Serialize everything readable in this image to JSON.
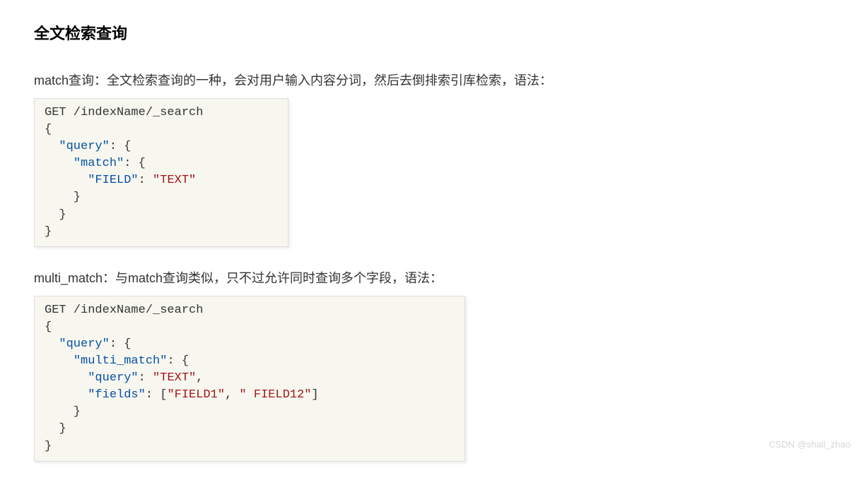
{
  "heading": "全文检索查询",
  "para1": "match查询：全文检索查询的一种，会对用户输入内容分词，然后去倒排索引库检索，语法：",
  "para2": "multi_match：与match查询类似，只不过允许同时查询多个字段，语法：",
  "watermark": "CSDN @shall_zhao",
  "code1": {
    "line1": "GET /indexName/_search",
    "line2": "{",
    "key_query": "\"query\"",
    "sep": ": {",
    "key_match": "\"match\"",
    "key_field": "\"FIELD\"",
    "colon": ": ",
    "val_text": "\"TEXT\"",
    "close1": "    }",
    "close2": "  }",
    "close3": "}"
  },
  "code2": {
    "line1": "GET /indexName/_search",
    "line2": "{",
    "key_query": "\"query\"",
    "sep": ": {",
    "key_multi": "\"multi_match\"",
    "key_q": "\"query\"",
    "colon": ": ",
    "val_text": "\"TEXT\"",
    "comma": ",",
    "key_fields": "\"fields\"",
    "arr_open": ": [",
    "val_f1": "\"FIELD1\"",
    "arr_sep": ", ",
    "val_f2": "\" FIELD12\"",
    "arr_close": "]",
    "close1": "    }",
    "close2": "  }",
    "close3": "}"
  }
}
